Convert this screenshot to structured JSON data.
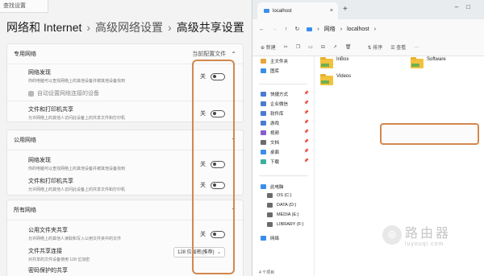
{
  "settings": {
    "top_search": "查找设置",
    "breadcrumb": [
      "网络和 Internet",
      "高级网络设置",
      "高级共享设置"
    ],
    "sections": {
      "private": {
        "title": "专用网络",
        "profile": "当前配置文件",
        "network_discovery": {
          "title": "网络发现",
          "desc": "你的电脑可以查找网络上的其他设备并被其他设备找到",
          "state": "关"
        },
        "auto_setup": "自动设置网络连接的设备",
        "file_printer": {
          "title": "文件和打印机共享",
          "desc": "允许网络上的其他人访问此设备上的共享文件和打印机",
          "state": "关"
        }
      },
      "public": {
        "title": "公用网络",
        "network_discovery": {
          "title": "网络发现",
          "desc": "你的电脑可以查找网络上的其他设备并被其他设备找到",
          "state": "关"
        },
        "file_printer": {
          "title": "文件和打印机共享",
          "desc": "允许网络上的其他人访问此设备上的共享文件和打印机",
          "state": "关"
        }
      },
      "all": {
        "title": "所有网络",
        "public_folder": {
          "title": "公用文件夹共享",
          "desc": "允许网络上的其他人读取和写入公用文件夹中的文件",
          "state": "关"
        },
        "encryption": {
          "title": "文件共享连接",
          "desc": "对共享的文件设备使用 128 位加密",
          "value": "128 位加密(推荐)"
        },
        "password": {
          "title": "密码保护的共享"
        }
      }
    }
  },
  "explorer": {
    "tab_title": "localhost",
    "path": [
      "网络",
      "localhost"
    ],
    "cmd": {
      "new": "新建",
      "sort": "排序",
      "view": "查看"
    },
    "nav": [
      {
        "label": "主文件夹",
        "color": "#e8a33b",
        "pin": false
      },
      {
        "label": "图库",
        "color": "#3b8fe8",
        "pin": false
      },
      {
        "label": "快捷方式",
        "color": "#4a7bd1",
        "pin": true
      },
      {
        "label": "企业微信",
        "color": "#4a7bd1",
        "pin": true
      },
      {
        "label": "软件库",
        "color": "#4a7bd1",
        "pin": true
      },
      {
        "label": "游戏",
        "color": "#4a7bd1",
        "pin": true
      },
      {
        "label": "视频",
        "color": "#8a5cd1",
        "pin": true
      },
      {
        "label": "文档",
        "color": "#6b6b6b",
        "pin": true
      },
      {
        "label": "桌面",
        "color": "#3b8fe8",
        "pin": true
      },
      {
        "label": "下载",
        "color": "#3bb0a0",
        "pin": true
      },
      {
        "label": "此电脑",
        "color": "#3b8fe8",
        "pin": false
      },
      {
        "label": "OS (C:)",
        "color": "#6b6b6b",
        "pin": false
      },
      {
        "label": "DATA (D:)",
        "color": "#6b6b6b",
        "pin": false
      },
      {
        "label": "MEDIA (E:)",
        "color": "#6b6b6b",
        "pin": false
      },
      {
        "label": "LIBRARY (F:)",
        "color": "#6b6b6b",
        "pin": false
      },
      {
        "label": "网络",
        "color": "#3b8fe8",
        "pin": false
      }
    ],
    "files": [
      "InBox",
      "Software",
      "Videos"
    ],
    "status": "4 个项目"
  },
  "watermark": {
    "main": "路由器",
    "sub": "luyouqi.com"
  }
}
